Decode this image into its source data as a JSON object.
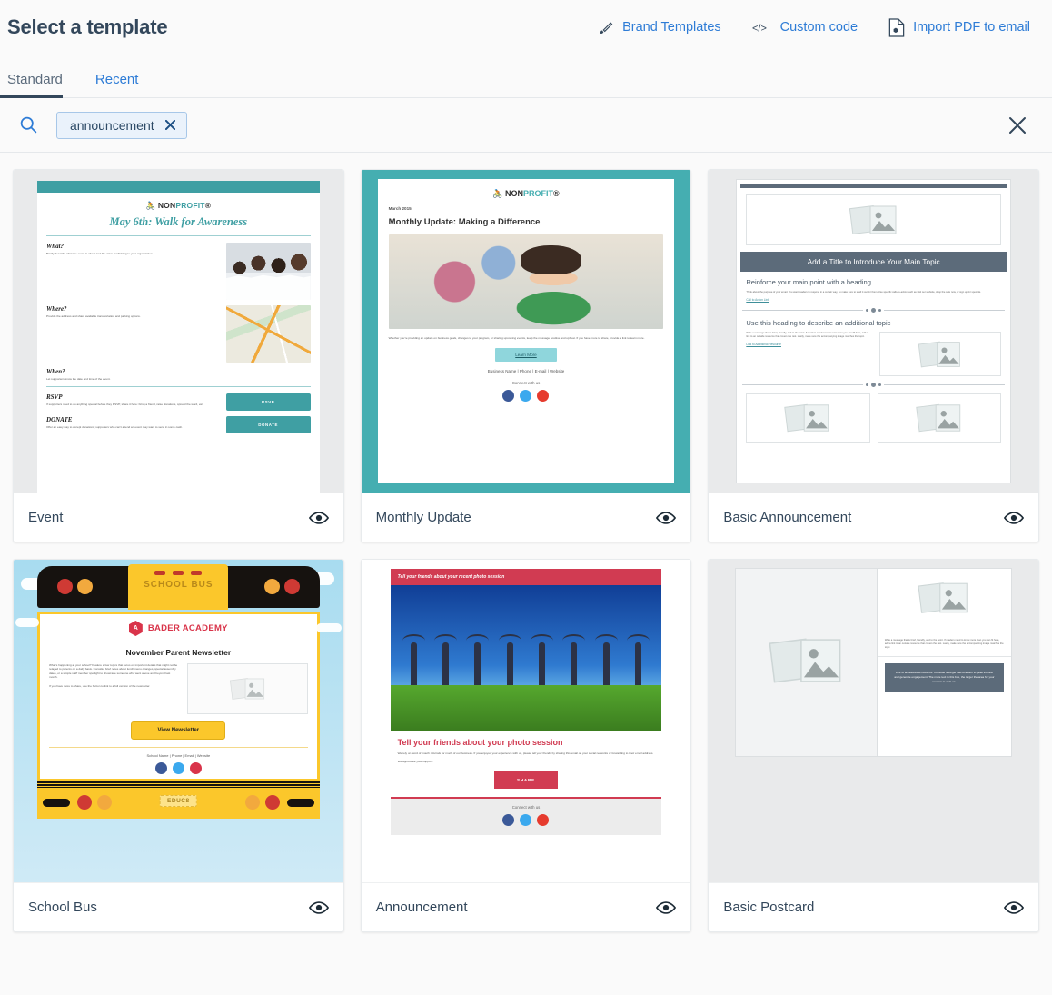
{
  "header": {
    "title": "Select a template",
    "actions": [
      {
        "id": "brand-templates",
        "label": "Brand Templates",
        "icon": "brush-icon"
      },
      {
        "id": "custom-code",
        "label": "Custom code",
        "icon": "code-icon"
      },
      {
        "id": "import-pdf",
        "label": "Import PDF to email",
        "icon": "pdf-file-icon"
      }
    ]
  },
  "tabs": [
    {
      "id": "standard",
      "label": "Standard",
      "active": true
    },
    {
      "id": "recent",
      "label": "Recent",
      "active": false
    }
  ],
  "search": {
    "icon": "search-icon",
    "chip": {
      "label": "announcement",
      "remove_icon": "chip-close-icon"
    },
    "close_icon": "close-icon"
  },
  "colors": {
    "accent_link": "#2e7cd6",
    "tab_underline": "#33475b",
    "chip_bg": "#eaf2fb",
    "chip_border": "#a7c7e8",
    "teal": "#3f9fa3",
    "teal_light": "#45aeb1",
    "slate": "#5c6b7a",
    "bus_yellow": "#fbc72b",
    "red": "#d13b52",
    "academy_red": "#d9344a"
  },
  "cards": [
    {
      "id": "event",
      "title": "Event",
      "preview_icon": "eye-icon",
      "content": {
        "logo": "NONPROFIT",
        "logo_prefix": "NON",
        "logo_suffix": "PROFIT",
        "heading": "May 6th: Walk for Awareness",
        "sections": [
          {
            "q": "What?",
            "body": "Briefly describe what the event is about and the value it will bring to your organization."
          },
          {
            "q": "Where?",
            "body": "Provide the address and share available transportation and parking options."
          },
          {
            "q": "When?",
            "body": "Let supporters know the date and time of the event."
          },
          {
            "q": "RSVP",
            "body": "If supporters need to do anything special before they RSVP, share it here: bring a friend, raise donations, spread the word, etc.",
            "button": "RSVP"
          },
          {
            "q": "DONATE",
            "body": "Offer an easy way to accept donations; supporters who can't attend an event may want to send in some cash.",
            "button": "DONATE"
          }
        ]
      }
    },
    {
      "id": "monthly-update",
      "title": "Monthly Update",
      "preview_icon": "eye-icon",
      "content": {
        "logo_prefix": "NON",
        "logo_suffix": "PROFIT",
        "date": "March 2015",
        "heading": "Monthly Update: Making a Difference",
        "body": "Whether you're providing an update on business goals, changes to your program, or sharing upcoming events, keep the message positive and upbeat. If you have more to share, provide a link to learn more.",
        "button": "Learn More",
        "footer_links": "Business Name | Phone | E-mail | Website",
        "connect": "Connect with us",
        "social": [
          "facebook-icon",
          "twitter-icon",
          "youtube-icon"
        ]
      }
    },
    {
      "id": "basic-announcement",
      "title": "Basic Announcement",
      "preview_icon": "eye-icon",
      "content": {
        "title_bar": "Add a Title to Introduce Your Main Topic",
        "heading_1": "Reinforce your main point with a heading.",
        "body_1": "Think about the purpose of your email. You want readers to respond in a certain way, so make sure to spell it out for them. Use specific calls-to-action such as visit our website, shop the sale now, or sign up for specials.",
        "link_1": "Call to Action Link",
        "heading_2": "Use this heading to describe an additional topic",
        "body_2": "Write a message that is brief, friendly, and to the point. If readers need to know more then you can fill here, add a link to an outside resource that covers the rest. Lastly, make sure the accompanying image matches the topic.",
        "link_2": "Link to Additional Resource"
      }
    },
    {
      "id": "school-bus",
      "title": "School Bus",
      "preview_icon": "eye-icon",
      "content": {
        "bus_sign": "SCHOOL BUS",
        "brand": "BADER ACADEMY",
        "badge_letter": "A",
        "heading": "November Parent Newsletter",
        "body_1": "What's happening at your school? Feature a few topics that focus on important details that might not be relayed to parents on a daily basis. Consider brief notes about lunch menu changes, special assembly dates, or a simple staff member spotlight to showcase someone who went above and beyond last month.",
        "body_2": "If you have more to share, use the button to link to a full version of the newsletter.",
        "button": "View Newsletter",
        "footer_links": "School Name | Phone | Email | Website",
        "plate": "EDUC8",
        "social": [
          "facebook-icon",
          "twitter-icon",
          "instagram-icon"
        ]
      }
    },
    {
      "id": "announcement",
      "title": "Announcement",
      "preview_icon": "eye-icon",
      "content": {
        "preheader": "Tell your friends about your recent photo session",
        "heading": "Tell your friends about your photo session",
        "body_1": "We rely on word of mouth referrals for much of our business. If you enjoyed your experience with us, please tell your friends by sharing this email on your social networks or forwarding to their email address.",
        "body_2": "We appreciate your support!",
        "button": "SHARE",
        "connect": "Connect with us",
        "social": [
          "facebook-icon",
          "twitter-icon",
          "youtube-icon"
        ]
      }
    },
    {
      "id": "basic-postcard",
      "title": "Basic Postcard",
      "preview_icon": "eye-icon",
      "content": {
        "body": "Write a message that is brief, friendly, and to the point. If readers need to know more than you can fit here, add a link to an outside resource that covers the rest. Lastly, make sure the accompanying image matches the topic.",
        "cta": "Link to an additional resource. Consider a longer call-to-action to peak interest and generate engagement. The more text in this box, the larger the area for your readers to click on."
      }
    }
  ]
}
